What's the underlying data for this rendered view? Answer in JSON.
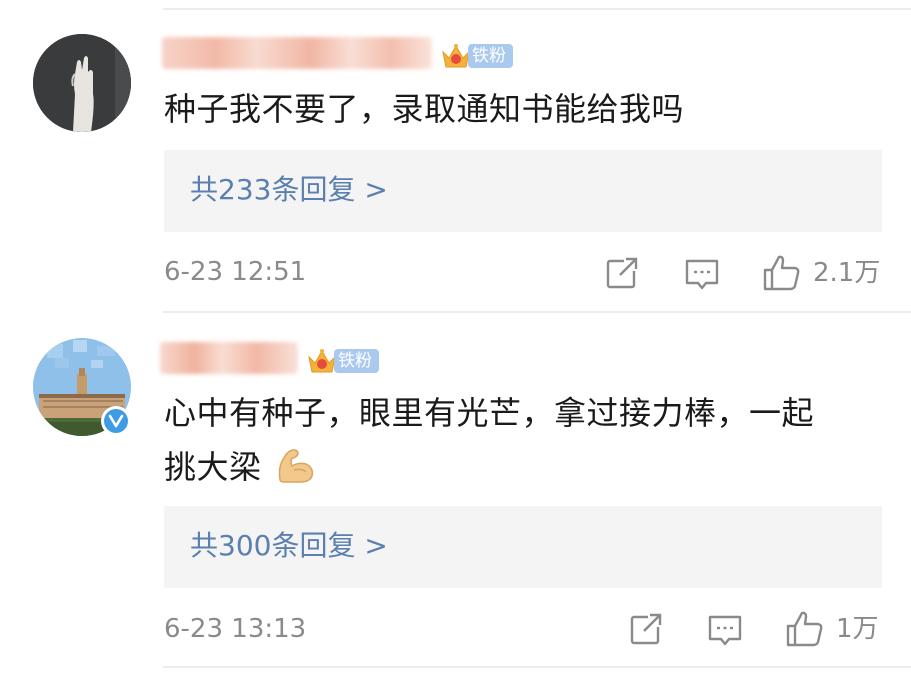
{
  "comments": [
    {
      "fan_badge": "铁粉",
      "text": "种子我不要了，录取通知书能给我吗",
      "replies": "共233条回复 >",
      "time": "6-23 12:51",
      "likes": "2.1万"
    },
    {
      "fan_badge": "铁粉",
      "text_line1": "心中有种子，眼里有光芒，拿过接力棒，一起",
      "text_line2": "挑大梁",
      "emoji": "flexed-biceps-emoji",
      "replies": "共300条回复 >",
      "time": "6-23 13:13",
      "likes": "1万"
    }
  ],
  "icons": {
    "share": "share-icon",
    "comment": "comment-icon",
    "like": "thumbs-up-icon",
    "crown": "crown-icon",
    "verified": "verified-icon"
  },
  "colors": {
    "link": "#5b7fae",
    "badge": "#a9c9ef",
    "meta": "#8a8a8a",
    "reply_bg": "#f4f4f4",
    "verified": "#3f9be4"
  }
}
